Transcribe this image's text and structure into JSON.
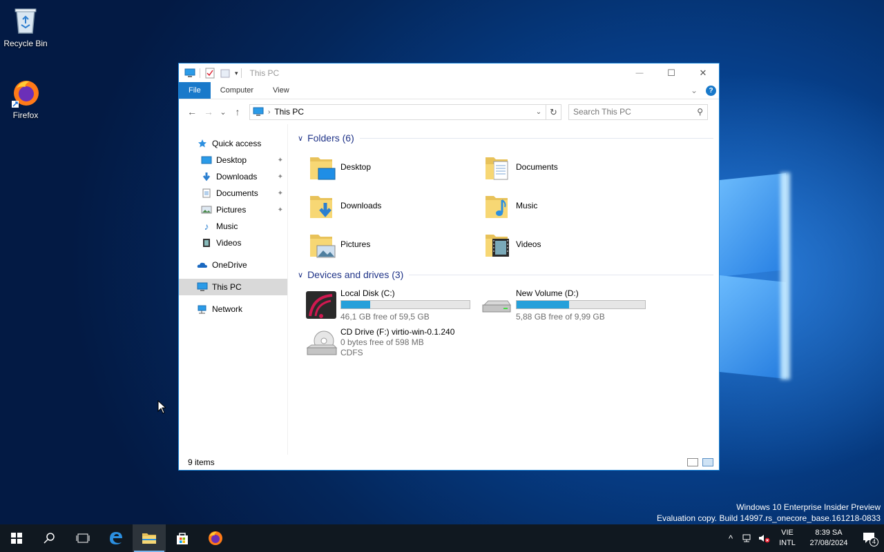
{
  "desktop": {
    "icons": [
      {
        "label": "Recycle Bin",
        "icon": "recycle-bin-icon"
      },
      {
        "label": "Firefox",
        "icon": "firefox-icon"
      }
    ],
    "watermark": {
      "line1": "Windows 10 Enterprise Insider Preview",
      "line2": "Evaluation copy. Build 14997.rs_onecore_base.161218-0833"
    }
  },
  "window": {
    "title": "This PC",
    "controls": {
      "minimize": "—",
      "maximize": "☐",
      "close": "✕"
    },
    "ribbon": {
      "tabs": [
        "File",
        "Computer",
        "View"
      ],
      "expand": "⌄",
      "help": "?"
    },
    "navbar": {
      "back": "←",
      "forward": "→",
      "recent": "⌄",
      "up": "↑",
      "address": "This PC",
      "address_sep": "›",
      "address_drop": "⌄",
      "refresh": "↻",
      "search_placeholder": "Search This PC",
      "search_icon": "⚲"
    },
    "nav_pane": {
      "quick_access": "Quick access",
      "quick_items": [
        {
          "label": "Desktop",
          "icon": "desktop-icon",
          "pinned": true
        },
        {
          "label": "Downloads",
          "icon": "downloads-icon",
          "pinned": true
        },
        {
          "label": "Documents",
          "icon": "documents-icon",
          "pinned": true
        },
        {
          "label": "Pictures",
          "icon": "pictures-icon",
          "pinned": true
        },
        {
          "label": "Music",
          "icon": "music-icon",
          "pinned": false
        },
        {
          "label": "Videos",
          "icon": "videos-icon",
          "pinned": false
        }
      ],
      "onedrive": "OneDrive",
      "this_pc": "This PC",
      "network": "Network",
      "pin_glyph": "📌"
    },
    "content": {
      "folders_header": "Folders (6)",
      "folders": [
        {
          "label": "Desktop",
          "icon": "desktop-folder-icon"
        },
        {
          "label": "Documents",
          "icon": "documents-folder-icon"
        },
        {
          "label": "Downloads",
          "icon": "downloads-folder-icon"
        },
        {
          "label": "Music",
          "icon": "music-folder-icon"
        },
        {
          "label": "Pictures",
          "icon": "pictures-folder-icon"
        },
        {
          "label": "Videos",
          "icon": "videos-folder-icon"
        }
      ],
      "drives_header": "Devices and drives (3)",
      "drives": [
        {
          "label": "Local Disk (C:)",
          "free": "46,1 GB free of 59,5 GB",
          "used_fraction": 0.225,
          "icon": "local-disk-icon"
        },
        {
          "label": "New Volume (D:)",
          "free": "5,88 GB free of 9,99 GB",
          "used_fraction": 0.41,
          "icon": "volume-disk-icon"
        },
        {
          "label": "CD Drive (F:) virtio-win-0.1.240",
          "free": "0 bytes free of 598 MB",
          "fs": "CDFS",
          "icon": "cd-drive-icon"
        }
      ]
    },
    "status": {
      "items": "9 items"
    }
  },
  "taskbar": {
    "lang_line1": "VIE",
    "lang_line2": "INTL",
    "time": "8:39 SA",
    "date": "27/08/2024",
    "notification_count": "4",
    "tray_chevron": "^",
    "accent": "#7bb6ee"
  }
}
